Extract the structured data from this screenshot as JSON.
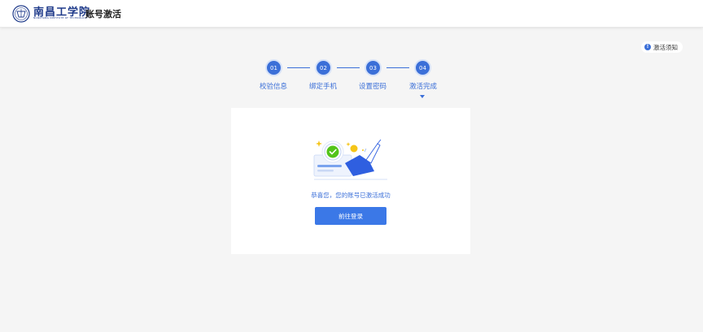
{
  "header": {
    "logo_text": "南昌工学院",
    "logo_subtitle": "NANCHANG INSTITUTE OF TECHNOLOGY",
    "page_title": "账号激活"
  },
  "notice": {
    "label": "激活须知",
    "icon": "info-icon"
  },
  "steps": [
    {
      "number": "01",
      "label": "校验信息"
    },
    {
      "number": "02",
      "label": "绑定手机"
    },
    {
      "number": "03",
      "label": "设置密码"
    },
    {
      "number": "04",
      "label": "激活完成"
    }
  ],
  "current_step": 4,
  "result": {
    "message": "恭喜您，您的账号已激活成功",
    "button_label": "前往登录"
  },
  "colors": {
    "primary": "#3b6fd8",
    "button": "#3b78e7",
    "background": "#f5f5f5",
    "success": "#52c41a"
  }
}
